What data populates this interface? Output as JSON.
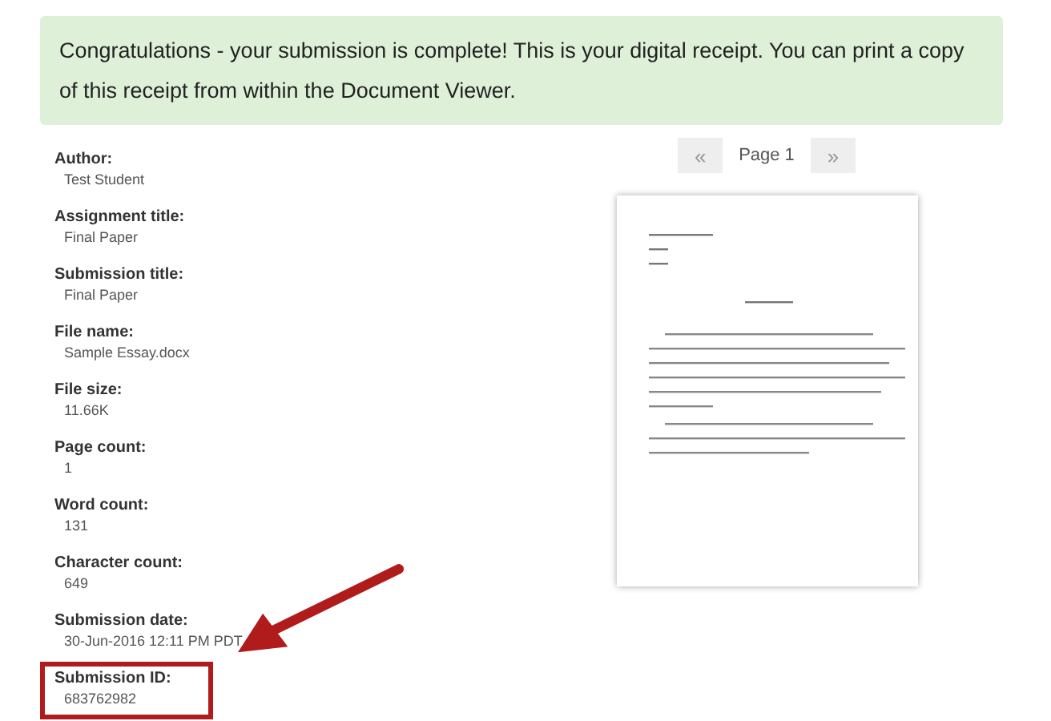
{
  "banner": {
    "message": "Congratulations - your submission is complete! This is your digital receipt. You can print a copy of this receipt from within the Document Viewer."
  },
  "details": [
    {
      "label": "Author:",
      "value": "Test Student",
      "highlighted": false
    },
    {
      "label": "Assignment title:",
      "value": "Final Paper",
      "highlighted": false
    },
    {
      "label": "Submission title:",
      "value": "Final Paper",
      "highlighted": false
    },
    {
      "label": "File name:",
      "value": "Sample Essay.docx",
      "highlighted": false
    },
    {
      "label": "File size:",
      "value": "11.66K",
      "highlighted": false
    },
    {
      "label": "Page count:",
      "value": "1",
      "highlighted": false
    },
    {
      "label": "Word count:",
      "value": "131",
      "highlighted": false
    },
    {
      "label": "Character count:",
      "value": "649",
      "highlighted": false
    },
    {
      "label": "Submission date:",
      "value": "30-Jun-2016 12:11 PM PDT",
      "highlighted": false
    },
    {
      "label": "Submission ID:",
      "value": "683762982",
      "highlighted": true
    }
  ],
  "viewer": {
    "previous": "«",
    "page_label": "Page 1",
    "next": "»"
  }
}
